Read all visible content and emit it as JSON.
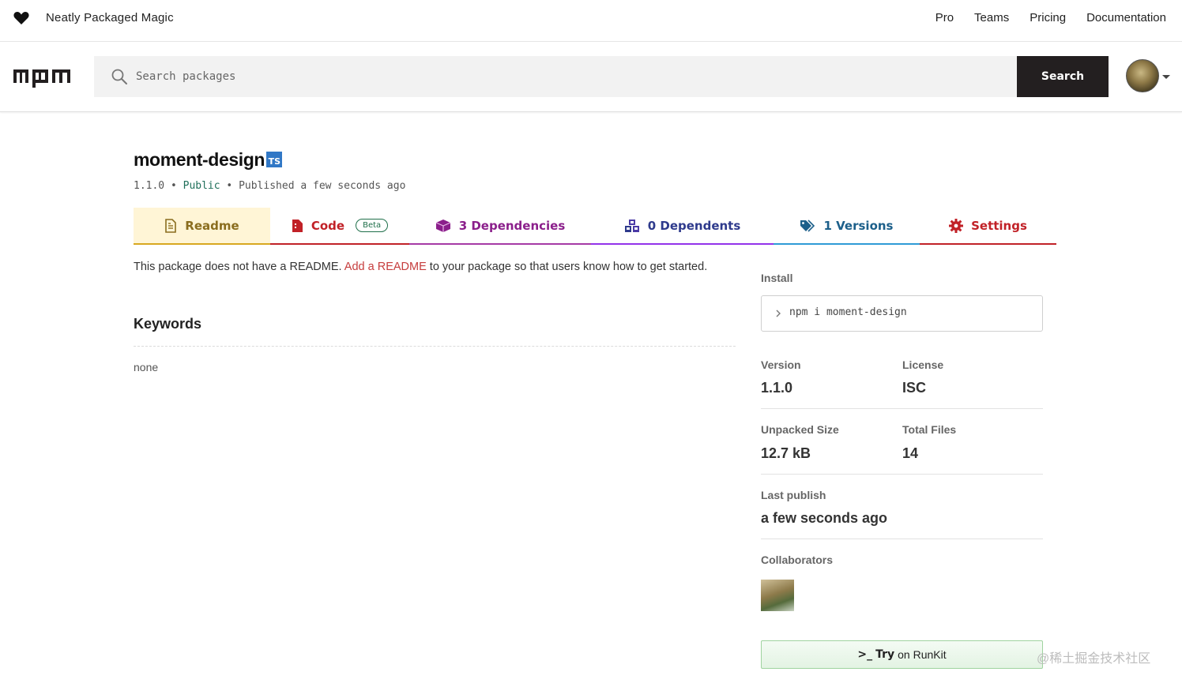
{
  "header": {
    "tagline": "Neatly Packaged Magic",
    "nav": [
      "Pro",
      "Teams",
      "Pricing",
      "Documentation"
    ]
  },
  "search": {
    "placeholder": "Search packages",
    "button_label": "Search"
  },
  "package": {
    "name": "moment-design",
    "ts_badge": "TS",
    "version": "1.1.0",
    "visibility": "Public",
    "published": "Published a few seconds ago",
    "separator": "•"
  },
  "tabs": {
    "readme": "Readme",
    "code": "Code",
    "code_badge": "Beta",
    "dependencies": "3 Dependencies",
    "dependents": "0 Dependents",
    "versions": "1 Versions",
    "settings": "Settings"
  },
  "readme": {
    "text_before": "This package does not have a README.",
    "link": "Add a README",
    "text_after": "to your package so that users know how to get started."
  },
  "keywords": {
    "title": "Keywords",
    "value": "none"
  },
  "sidebar": {
    "install_label": "Install",
    "install_command": "npm i moment-design",
    "version_label": "Version",
    "version_value": "1.1.0",
    "license_label": "License",
    "license_value": "ISC",
    "size_label": "Unpacked Size",
    "size_value": "12.7 kB",
    "files_label": "Total Files",
    "files_value": "14",
    "last_publish_label": "Last publish",
    "last_publish_value": "a few seconds ago",
    "collaborators_label": "Collaborators",
    "runkit_prefix": ">_",
    "runkit_try": "Try",
    "runkit_rest": "on RunKit"
  },
  "watermark": "@稀土掘金技术社区",
  "colors": {
    "search_button": "#231f20",
    "ts_badge": "#3178c6",
    "readme_link": "#c63d3d"
  }
}
